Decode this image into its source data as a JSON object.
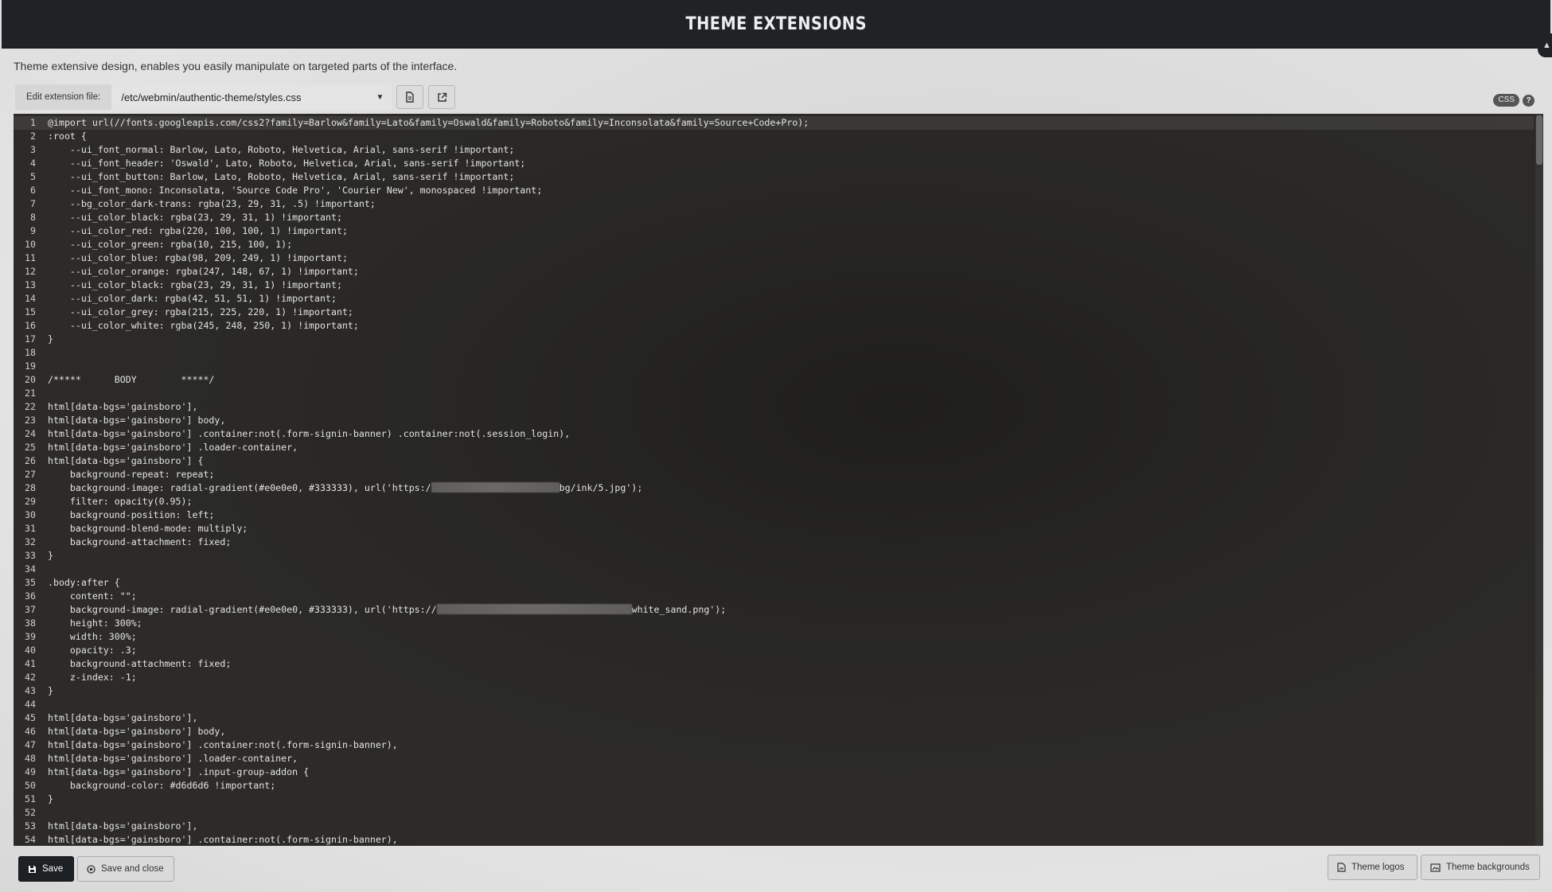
{
  "header": {
    "title": "THEME EXTENSIONS"
  },
  "description": "Theme extensive design, enables you easily manipulate on targeted parts of the interface.",
  "toolbar": {
    "edit_label": "Edit extension file:",
    "selected_file": "/etc/webmin/authentic-theme/styles.css",
    "copy_icon": "file-copy-icon",
    "open_icon": "external-link-icon"
  },
  "badges": {
    "mode": "CSS",
    "help": "?"
  },
  "editor": {
    "lines": [
      {
        "n": "1",
        "text": "@import url(//fonts.googleapis.com/css2?family=Barlow&family=Lato&family=Oswald&family=Roboto&family=Inconsolata&family=Source+Code+Pro);"
      },
      {
        "n": "2",
        "text": ":root {"
      },
      {
        "n": "3",
        "text": "    --ui_font_normal: Barlow, Lato, Roboto, Helvetica, Arial, sans-serif !important;"
      },
      {
        "n": "4",
        "text": "    --ui_font_header: 'Oswald', Lato, Roboto, Helvetica, Arial, sans-serif !important;"
      },
      {
        "n": "5",
        "text": "    --ui_font_button: Barlow, Lato, Roboto, Helvetica, Arial, sans-serif !important;"
      },
      {
        "n": "6",
        "text": "    --ui_font_mono: Inconsolata, 'Source Code Pro', 'Courier New', monospaced !important;"
      },
      {
        "n": "7",
        "text": "    --bg_color_dark-trans: rgba(23, 29, 31, .5) !important;"
      },
      {
        "n": "8",
        "text": "    --ui_color_black: rgba(23, 29, 31, 1) !important;"
      },
      {
        "n": "9",
        "text": "    --ui_color_red: rgba(220, 100, 100, 1) !important;"
      },
      {
        "n": "10",
        "text": "    --ui_color_green: rgba(10, 215, 100, 1);"
      },
      {
        "n": "11",
        "text": "    --ui_color_blue: rgba(98, 209, 249, 1) !important;"
      },
      {
        "n": "12",
        "text": "    --ui_color_orange: rgba(247, 148, 67, 1) !important;"
      },
      {
        "n": "13",
        "text": "    --ui_color_black: rgba(23, 29, 31, 1) !important;"
      },
      {
        "n": "14",
        "text": "    --ui_color_dark: rgba(42, 51, 51, 1) !important;"
      },
      {
        "n": "15",
        "text": "    --ui_color_grey: rgba(215, 225, 220, 1) !important;"
      },
      {
        "n": "16",
        "text": "    --ui_color_white: rgba(245, 248, 250, 1) !important;"
      },
      {
        "n": "17",
        "text": "}"
      },
      {
        "n": "18",
        "text": ""
      },
      {
        "n": "19",
        "text": ""
      },
      {
        "n": "20",
        "text": "/*****      BODY        *****/"
      },
      {
        "n": "21",
        "text": ""
      },
      {
        "n": "22",
        "text": "html[data-bgs='gainsboro'],"
      },
      {
        "n": "23",
        "text": "html[data-bgs='gainsboro'] body,"
      },
      {
        "n": "24",
        "text": "html[data-bgs='gainsboro'] .container:not(.form-signin-banner) .container:not(.session_login),"
      },
      {
        "n": "25",
        "text": "html[data-bgs='gainsboro'] .loader-container,"
      },
      {
        "n": "26",
        "text": "html[data-bgs='gainsboro'] {"
      },
      {
        "n": "27",
        "text": "    background-repeat: repeat;"
      },
      {
        "n": "28",
        "text": "    background-image: radial-gradient(#e0e0e0, #333333), url('https:/",
        "redact_chars": 23,
        "after": "bg/ink/5.jpg');"
      },
      {
        "n": "29",
        "text": "    filter: opacity(0.95);"
      },
      {
        "n": "30",
        "text": "    background-position: left;"
      },
      {
        "n": "31",
        "text": "    background-blend-mode: multiply;"
      },
      {
        "n": "32",
        "text": "    background-attachment: fixed;"
      },
      {
        "n": "33",
        "text": "}"
      },
      {
        "n": "34",
        "text": ""
      },
      {
        "n": "35",
        "text": ".body:after {"
      },
      {
        "n": "36",
        "text": "    content: \"\";"
      },
      {
        "n": "37",
        "text": "    background-image: radial-gradient(#e0e0e0, #333333), url('https://",
        "redact_chars": 35,
        "after": "white_sand.png');"
      },
      {
        "n": "38",
        "text": "    height: 300%;"
      },
      {
        "n": "39",
        "text": "    width: 300%;"
      },
      {
        "n": "40",
        "text": "    opacity: .3;"
      },
      {
        "n": "41",
        "text": "    background-attachment: fixed;"
      },
      {
        "n": "42",
        "text": "    z-index: -1;"
      },
      {
        "n": "43",
        "text": "}"
      },
      {
        "n": "44",
        "text": ""
      },
      {
        "n": "45",
        "text": "html[data-bgs='gainsboro'],"
      },
      {
        "n": "46",
        "text": "html[data-bgs='gainsboro'] body,"
      },
      {
        "n": "47",
        "text": "html[data-bgs='gainsboro'] .container:not(.form-signin-banner),"
      },
      {
        "n": "48",
        "text": "html[data-bgs='gainsboro'] .loader-container,"
      },
      {
        "n": "49",
        "text": "html[data-bgs='gainsboro'] .input-group-addon {"
      },
      {
        "n": "50",
        "text": "    background-color: #d6d6d6 !important;"
      },
      {
        "n": "51",
        "text": "}"
      },
      {
        "n": "52",
        "text": ""
      },
      {
        "n": "53",
        "text": "html[data-bgs='gainsboro'],"
      },
      {
        "n": "54",
        "text": "html[data-bgs='gainsboro'] .container:not(.form-signin-banner),"
      }
    ]
  },
  "footer": {
    "save_label": "Save",
    "save_close_label": "Save and close",
    "theme_logos_label": "Theme logos",
    "theme_backgrounds_label": "Theme backgrounds"
  },
  "colors": {
    "header_bg": "#1f2325",
    "editor_bg": "#2c2b28",
    "page_bg": "#dcdcdc",
    "primary_button": "#1d2123"
  }
}
